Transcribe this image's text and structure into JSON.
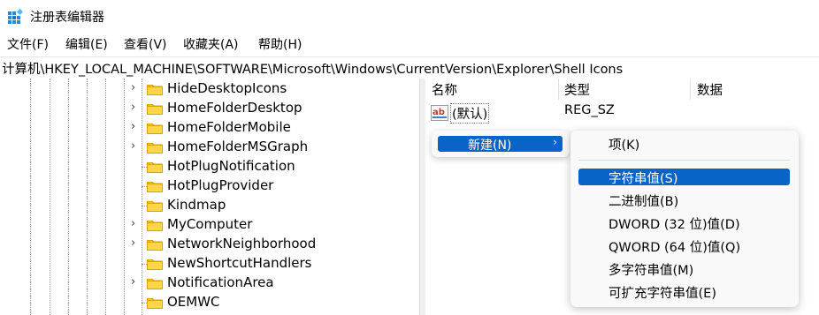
{
  "window": {
    "title": "注册表编辑器"
  },
  "menu": [
    "文件(F)",
    "编辑(E)",
    "查看(V)",
    "收藏夹(A)",
    "帮助(H)"
  ],
  "address": "计算机\\HKEY_LOCAL_MACHINE\\SOFTWARE\\Microsoft\\Windows\\CurrentVersion\\Explorer\\Shell Icons",
  "tree": [
    {
      "label": "HideDesktopIcons",
      "expandable": true
    },
    {
      "label": "HomeFolderDesktop",
      "expandable": true
    },
    {
      "label": "HomeFolderMobile",
      "expandable": true
    },
    {
      "label": "HomeFolderMSGraph",
      "expandable": true
    },
    {
      "label": "HotPlugNotification",
      "expandable": false
    },
    {
      "label": "HotPlugProvider",
      "expandable": false
    },
    {
      "label": "Kindmap",
      "expandable": false
    },
    {
      "label": "MyComputer",
      "expandable": true
    },
    {
      "label": "NetworkNeighborhood",
      "expandable": true
    },
    {
      "label": "NewShortcutHandlers",
      "expandable": false
    },
    {
      "label": "NotificationArea",
      "expandable": true
    },
    {
      "label": "OEMWC",
      "expandable": false
    }
  ],
  "list": {
    "headers": {
      "name": "名称",
      "type": "类型",
      "data": "数据"
    },
    "rows": [
      {
        "name": "(默认)",
        "type": "REG_SZ",
        "data": ""
      }
    ]
  },
  "context_menu": {
    "new_label": "新建(N)",
    "arrow": "›"
  },
  "submenu": [
    "项(K)",
    "字符串值(S)",
    "二进制值(B)",
    "DWORD (32 位)值(D)",
    "QWORD (64 位)值(Q)",
    "多字符串值(M)",
    "可扩充字符串值(E)"
  ],
  "colors": {
    "selection": "#0a64c8",
    "folder": "#f5c518"
  }
}
